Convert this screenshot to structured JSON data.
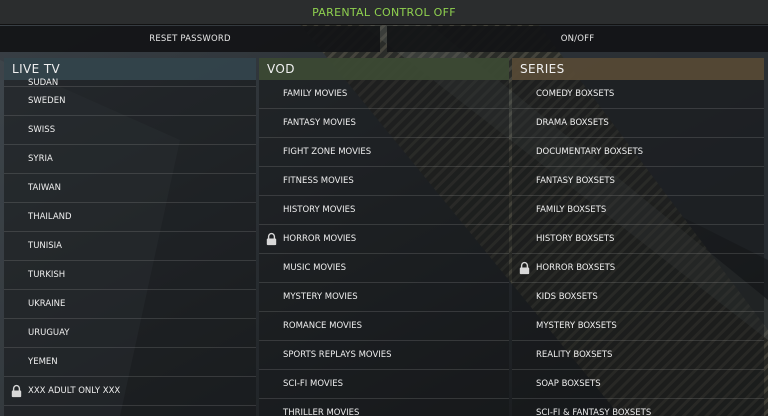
{
  "topbar": {
    "title": "PARENTAL CONTROL OFF"
  },
  "buttons": {
    "reset": "RESET PASSWORD",
    "toggle": "ON/OFF"
  },
  "columns": {
    "live_tv": {
      "title": "LIVE TV",
      "items": [
        {
          "label": "SUDAN",
          "locked": false
        },
        {
          "label": "SWEDEN",
          "locked": false
        },
        {
          "label": "SWISS",
          "locked": false
        },
        {
          "label": "SYRIA",
          "locked": false
        },
        {
          "label": "TAIWAN",
          "locked": false
        },
        {
          "label": "THAILAND",
          "locked": false
        },
        {
          "label": "TUNISIA",
          "locked": false
        },
        {
          "label": "TURKISH",
          "locked": false
        },
        {
          "label": "UKRAINE",
          "locked": false
        },
        {
          "label": "URUGUAY",
          "locked": false
        },
        {
          "label": "YEMEN",
          "locked": false
        },
        {
          "label": "XXX ADULT ONLY XXX",
          "locked": true
        }
      ]
    },
    "vod": {
      "title": "VOD",
      "items": [
        {
          "label": "FAMILY MOVIES",
          "locked": false
        },
        {
          "label": "FANTASY MOVIES",
          "locked": false
        },
        {
          "label": "FIGHT ZONE MOVIES",
          "locked": false
        },
        {
          "label": "FITNESS MOVIES",
          "locked": false
        },
        {
          "label": "HISTORY MOVIES",
          "locked": false
        },
        {
          "label": "HORROR MOVIES",
          "locked": true
        },
        {
          "label": "MUSIC MOVIES",
          "locked": false
        },
        {
          "label": "MYSTERY MOVIES",
          "locked": false
        },
        {
          "label": "ROMANCE MOVIES",
          "locked": false
        },
        {
          "label": "SPORTS REPLAYS MOVIES",
          "locked": false
        },
        {
          "label": "SCI-FI MOVIES",
          "locked": false
        },
        {
          "label": "THRILLER MOVIES",
          "locked": false
        }
      ]
    },
    "series": {
      "title": "SERIES",
      "items": [
        {
          "label": "COMEDY BOXSETS",
          "locked": false
        },
        {
          "label": "DRAMA BOXSETS",
          "locked": false
        },
        {
          "label": "DOCUMENTARY BOXSETS",
          "locked": false
        },
        {
          "label": "FANTASY BOXSETS",
          "locked": false
        },
        {
          "label": "FAMILY BOXSETS",
          "locked": false
        },
        {
          "label": "HISTORY BOXSETS",
          "locked": false
        },
        {
          "label": "HORROR BOXSETS",
          "locked": true
        },
        {
          "label": "KIDS BOXSETS",
          "locked": false
        },
        {
          "label": "MYSTERY BOXSETS",
          "locked": false
        },
        {
          "label": "REALITY BOXSETS",
          "locked": false
        },
        {
          "label": "SOAP BOXSETS",
          "locked": false
        },
        {
          "label": "SCI-FI & FANTASY BOXSETS",
          "locked": false
        }
      ]
    }
  },
  "colors": {
    "accent_green": "#8fd14f",
    "live_tv_header": "#34444c",
    "vod_header": "#3c4a34",
    "series_header": "#564a36"
  },
  "icons": {
    "lock": "padlock-icon"
  }
}
